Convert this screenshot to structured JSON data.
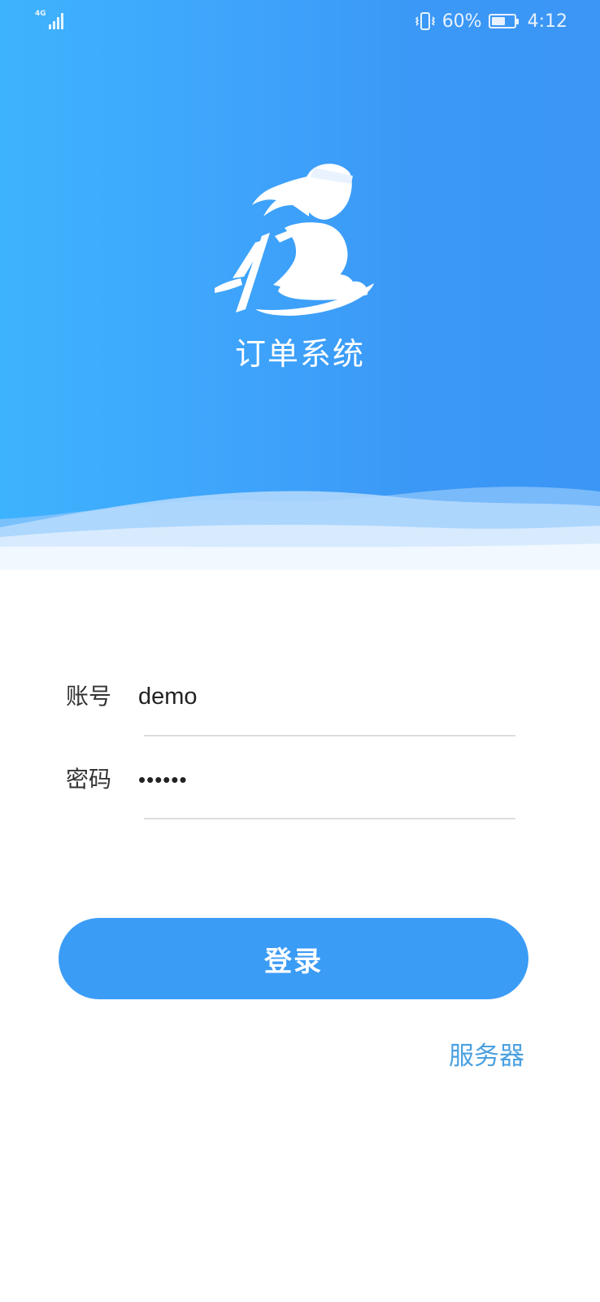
{
  "status_bar": {
    "network": "4G",
    "battery_percent": "60%",
    "battery_level": 0.6,
    "time": "4:12",
    "icons": [
      "signal-icon",
      "vibrate-icon",
      "battery-icon"
    ]
  },
  "header": {
    "logo_icon": "swordsman-logo-icon",
    "app_title": "订单系统"
  },
  "form": {
    "account": {
      "label": "账号",
      "value": "demo"
    },
    "password": {
      "label": "密码",
      "value": "••••••"
    }
  },
  "actions": {
    "login_label": "登录",
    "server_label": "服务器"
  },
  "colors": {
    "accent": "#3b9cf6",
    "header_start": "#3eb3fd",
    "header_end": "#3b96f5",
    "link": "#4aa0e0"
  }
}
